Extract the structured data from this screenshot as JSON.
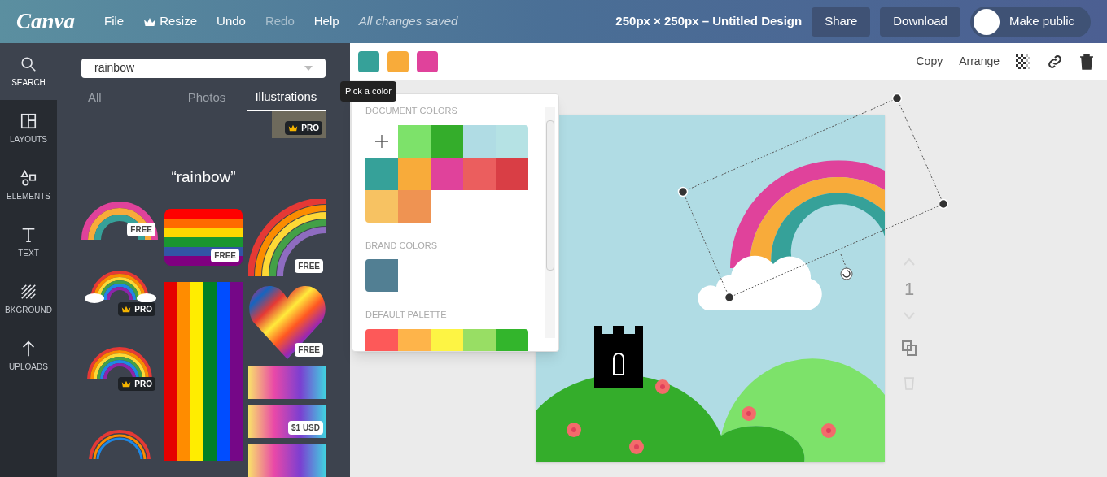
{
  "topbar": {
    "logo": "Canva",
    "menu": [
      {
        "label": "File",
        "crown": false,
        "disabled": false
      },
      {
        "label": "Resize",
        "crown": true,
        "disabled": false
      },
      {
        "label": "Undo",
        "crown": false,
        "disabled": false
      },
      {
        "label": "Redo",
        "crown": false,
        "disabled": true
      },
      {
        "label": "Help",
        "crown": false,
        "disabled": false
      }
    ],
    "status": "All changes saved",
    "title": "250px × 250px – Untitled Design",
    "buttons": [
      "Share",
      "Download"
    ],
    "public_toggle": {
      "label": "Make public",
      "on": false
    }
  },
  "sidebar": {
    "items": [
      {
        "kind": "search",
        "label": "SEARCH",
        "selected": true
      },
      {
        "kind": "layouts",
        "label": "LAYOUTS",
        "selected": false
      },
      {
        "kind": "elements",
        "label": "ELEMENTS",
        "selected": false
      },
      {
        "kind": "text",
        "label": "TEXT",
        "selected": false
      },
      {
        "kind": "background",
        "label": "BKGROUND",
        "selected": false
      },
      {
        "kind": "uploads",
        "label": "UPLOADS",
        "selected": false
      }
    ]
  },
  "search_panel": {
    "query": "rainbow",
    "tabs": [
      {
        "label": "All",
        "selected": false
      },
      {
        "label": "Photos",
        "selected": false
      },
      {
        "label": "Illustrations",
        "selected": true
      }
    ],
    "top_result": {
      "badge": "PRO",
      "pro": true
    },
    "heading": "“rainbow”",
    "columns": [
      [
        {
          "kind": "arc",
          "badge": "FREE",
          "pro": false
        },
        {
          "kind": "cloud-arc",
          "badge": "PRO",
          "pro": true
        },
        {
          "kind": "thin-arc",
          "badge": "PRO",
          "pro": true
        },
        {
          "kind": "ring"
        }
      ],
      [
        {
          "kind": "flag",
          "badge": "FREE",
          "pro": false
        },
        {
          "kind": "stripes"
        }
      ],
      [
        {
          "kind": "quarter",
          "badge": "FREE",
          "pro": false
        },
        {
          "kind": "heart",
          "badge": "FREE",
          "pro": false
        },
        {
          "kind": "texture"
        },
        {
          "kind": "texture",
          "badge": "$1 USD",
          "pro": false
        },
        {
          "kind": "texture"
        }
      ]
    ]
  },
  "toolbar": {
    "swatches": [
      {
        "color": "#36a199"
      },
      {
        "color": "#f8ab3a"
      },
      {
        "color": "#e0429b"
      }
    ],
    "tooltip": "Pick a color",
    "actions": [
      "Copy",
      "Arrange"
    ]
  },
  "color_picker": {
    "sections": [
      {
        "title": "DOCUMENT COLORS",
        "add": true,
        "colors": [
          {
            "color": "#7de26a"
          },
          {
            "color": "#34ad2b"
          },
          {
            "color": "#b0dce4"
          },
          {
            "color": "#b5e2e4"
          },
          {
            "color": "#36a199"
          },
          {
            "color": "#f8ab3a"
          },
          {
            "color": "#e0429b"
          },
          {
            "color": "#eb5e5e"
          },
          {
            "color": "#d93e45"
          },
          {
            "color": "#f7c262"
          },
          {
            "color": "#ef9352"
          }
        ]
      },
      {
        "title": "BRAND COLORS",
        "add": false,
        "colors": [
          {
            "color": "#527f93"
          }
        ]
      },
      {
        "title": "DEFAULT PALETTE",
        "add": false,
        "colors": [
          {
            "color": "#fd5959"
          },
          {
            "color": "#feb44a"
          },
          {
            "color": "#fdf444"
          },
          {
            "color": "#98de64"
          },
          {
            "color": "#33b52c"
          }
        ]
      }
    ]
  },
  "page_controls": {
    "page": "1"
  }
}
